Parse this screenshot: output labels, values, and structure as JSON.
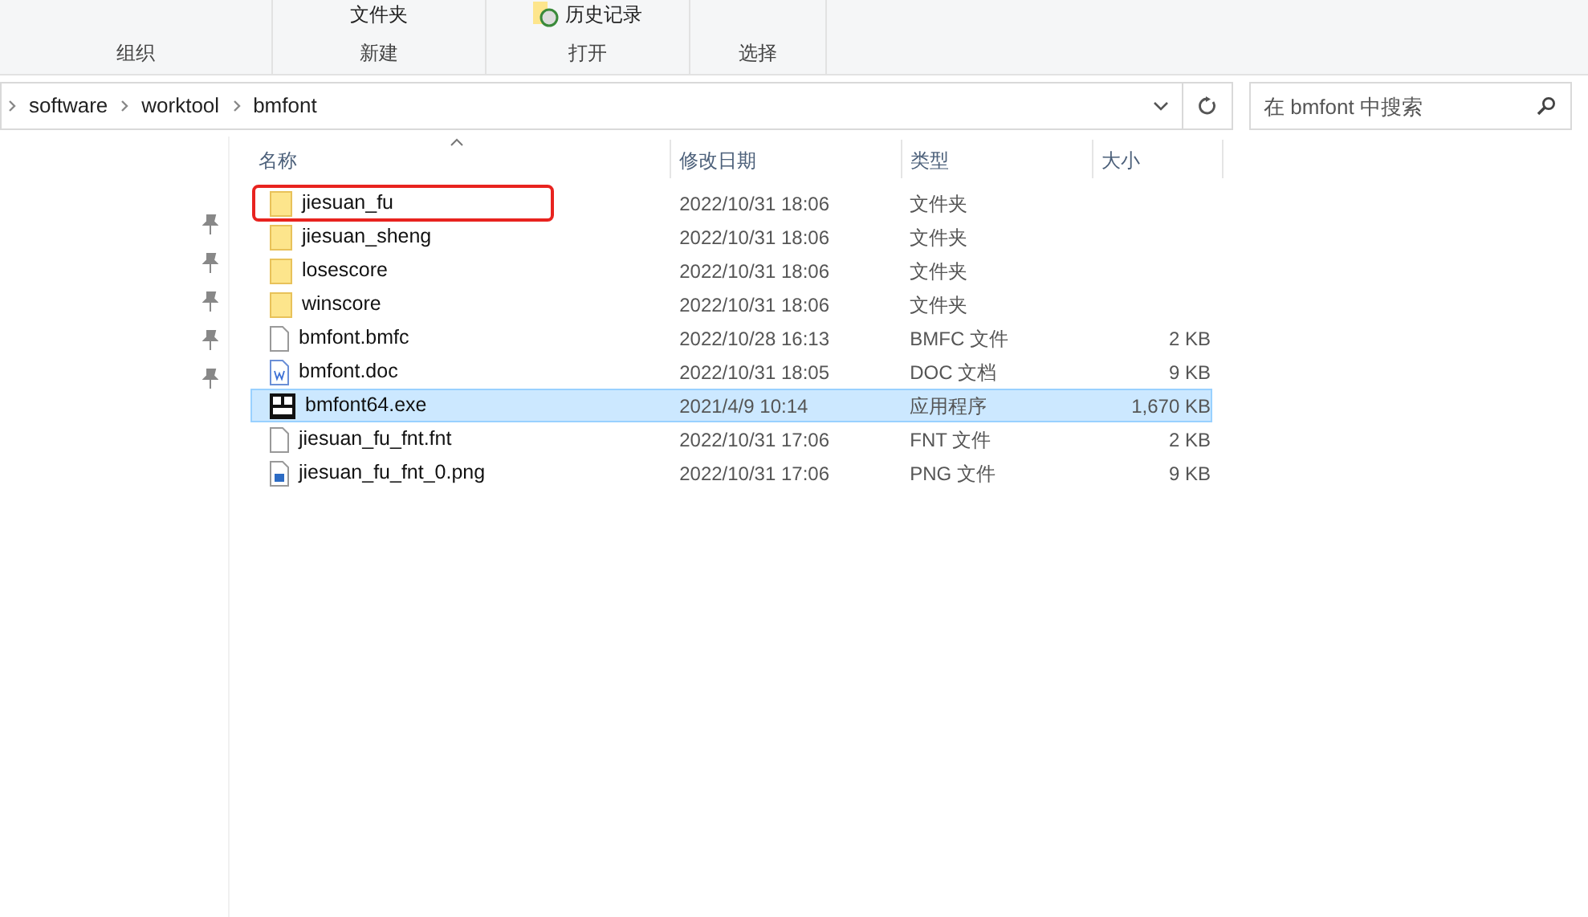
{
  "ribbon": {
    "groups": [
      {
        "label": "组织"
      },
      {
        "label": "新建",
        "items": [
          {
            "kind": "text",
            "label": "文件夹"
          }
        ]
      },
      {
        "label": "打开",
        "items": [
          {
            "kind": "history",
            "label": "历史记录"
          }
        ]
      },
      {
        "label": "选择"
      }
    ]
  },
  "address_bar": {
    "path": [
      "software",
      "worktool",
      "bmfont"
    ]
  },
  "search": {
    "placeholder": "在 bmfont 中搜索"
  },
  "table": {
    "columns": [
      "名称",
      "修改日期",
      "类型",
      "大小"
    ],
    "rows": [
      {
        "name": "jiesuan_fu",
        "kind": "folder",
        "date": "2022/10/31 18:06",
        "type": "文件夹",
        "size": "",
        "selected": false,
        "outlined": true
      },
      {
        "name": "jiesuan_sheng",
        "kind": "folder",
        "date": "2022/10/31 18:06",
        "type": "文件夹",
        "size": "",
        "selected": false,
        "outlined": false
      },
      {
        "name": "losescore",
        "kind": "folder",
        "date": "2022/10/31 18:06",
        "type": "文件夹",
        "size": "",
        "selected": false,
        "outlined": false
      },
      {
        "name": "winscore",
        "kind": "folder",
        "date": "2022/10/31 18:06",
        "type": "文件夹",
        "size": "",
        "selected": false,
        "outlined": false
      },
      {
        "name": "bmfont.bmfc",
        "kind": "file",
        "date": "2022/10/28 16:13",
        "type": "BMFC 文件",
        "size": "2 KB",
        "selected": false,
        "outlined": false
      },
      {
        "name": "bmfont.doc",
        "kind": "doc",
        "date": "2022/10/31 18:05",
        "type": "DOC 文档",
        "size": "9 KB",
        "selected": false,
        "outlined": false
      },
      {
        "name": "bmfont64.exe",
        "kind": "exe",
        "date": "2021/4/9 10:14",
        "type": "应用程序",
        "size": "1,670 KB",
        "selected": true,
        "outlined": false
      },
      {
        "name": "jiesuan_fu_fnt.fnt",
        "kind": "file",
        "date": "2022/10/31 17:06",
        "type": "FNT 文件",
        "size": "2 KB",
        "selected": false,
        "outlined": false
      },
      {
        "name": "jiesuan_fu_fnt_0.png",
        "kind": "image",
        "date": "2022/10/31 17:06",
        "type": "PNG 文件",
        "size": "9 KB",
        "selected": false,
        "outlined": false
      }
    ]
  }
}
